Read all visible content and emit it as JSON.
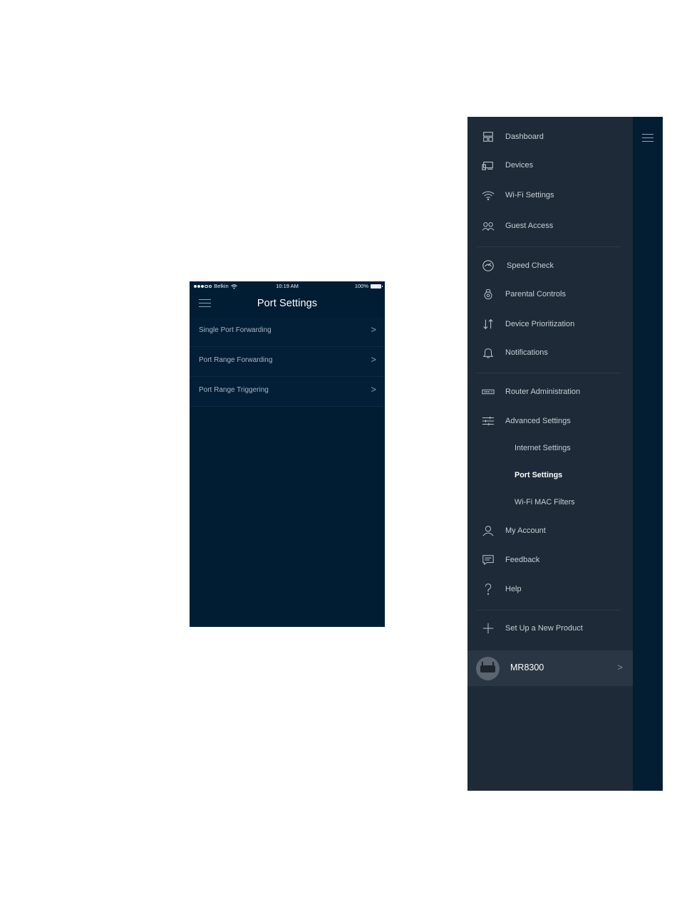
{
  "phone": {
    "status": {
      "carrier": "Belkin",
      "time": "10:19 AM",
      "battery": "100%"
    },
    "title": "Port Settings",
    "rows": [
      {
        "label": "Single Port Forwarding",
        "chevron": ">"
      },
      {
        "label": "Port Range Forwarding",
        "chevron": ">"
      },
      {
        "label": "Port Range Triggering",
        "chevron": ">"
      }
    ]
  },
  "drawer": {
    "items": [
      {
        "label": "Dashboard",
        "icon": "dashboard-icon"
      },
      {
        "label": "Devices",
        "icon": "devices-icon"
      },
      {
        "label": "Wi-Fi Settings",
        "icon": "wifi-icon"
      },
      {
        "label": "Guest Access",
        "icon": "guest-access-icon"
      },
      {
        "label": "Speed Check",
        "icon": "speedometer-icon"
      },
      {
        "label": "Parental Controls",
        "icon": "parental-controls-icon"
      },
      {
        "label": "Device Prioritization",
        "icon": "prioritization-arrows-icon"
      },
      {
        "label": "Notifications",
        "icon": "bell-icon"
      },
      {
        "label": "Router Administration",
        "icon": "router-icon"
      },
      {
        "label": "Advanced Settings",
        "icon": "sliders-icon"
      },
      {
        "label": "My Account",
        "icon": "user-icon"
      },
      {
        "label": "Feedback",
        "icon": "feedback-icon"
      },
      {
        "label": "Help",
        "icon": "help-icon"
      },
      {
        "label": "Set Up a New Product",
        "icon": "plus-icon"
      }
    ],
    "advanced_sub": [
      {
        "label": "Internet Settings",
        "active": false
      },
      {
        "label": "Port Settings",
        "active": true
      },
      {
        "label": "Wi-Fi MAC Filters",
        "active": false
      }
    ],
    "device": {
      "name": "MR8300",
      "chevron": ">"
    }
  },
  "colors": {
    "phone_bg": "#001d33",
    "drawer_menu_bg": "#1e2a37",
    "drawer_bg": "#031d33",
    "text_light": "#c6ced6",
    "active": "#ffffff"
  }
}
